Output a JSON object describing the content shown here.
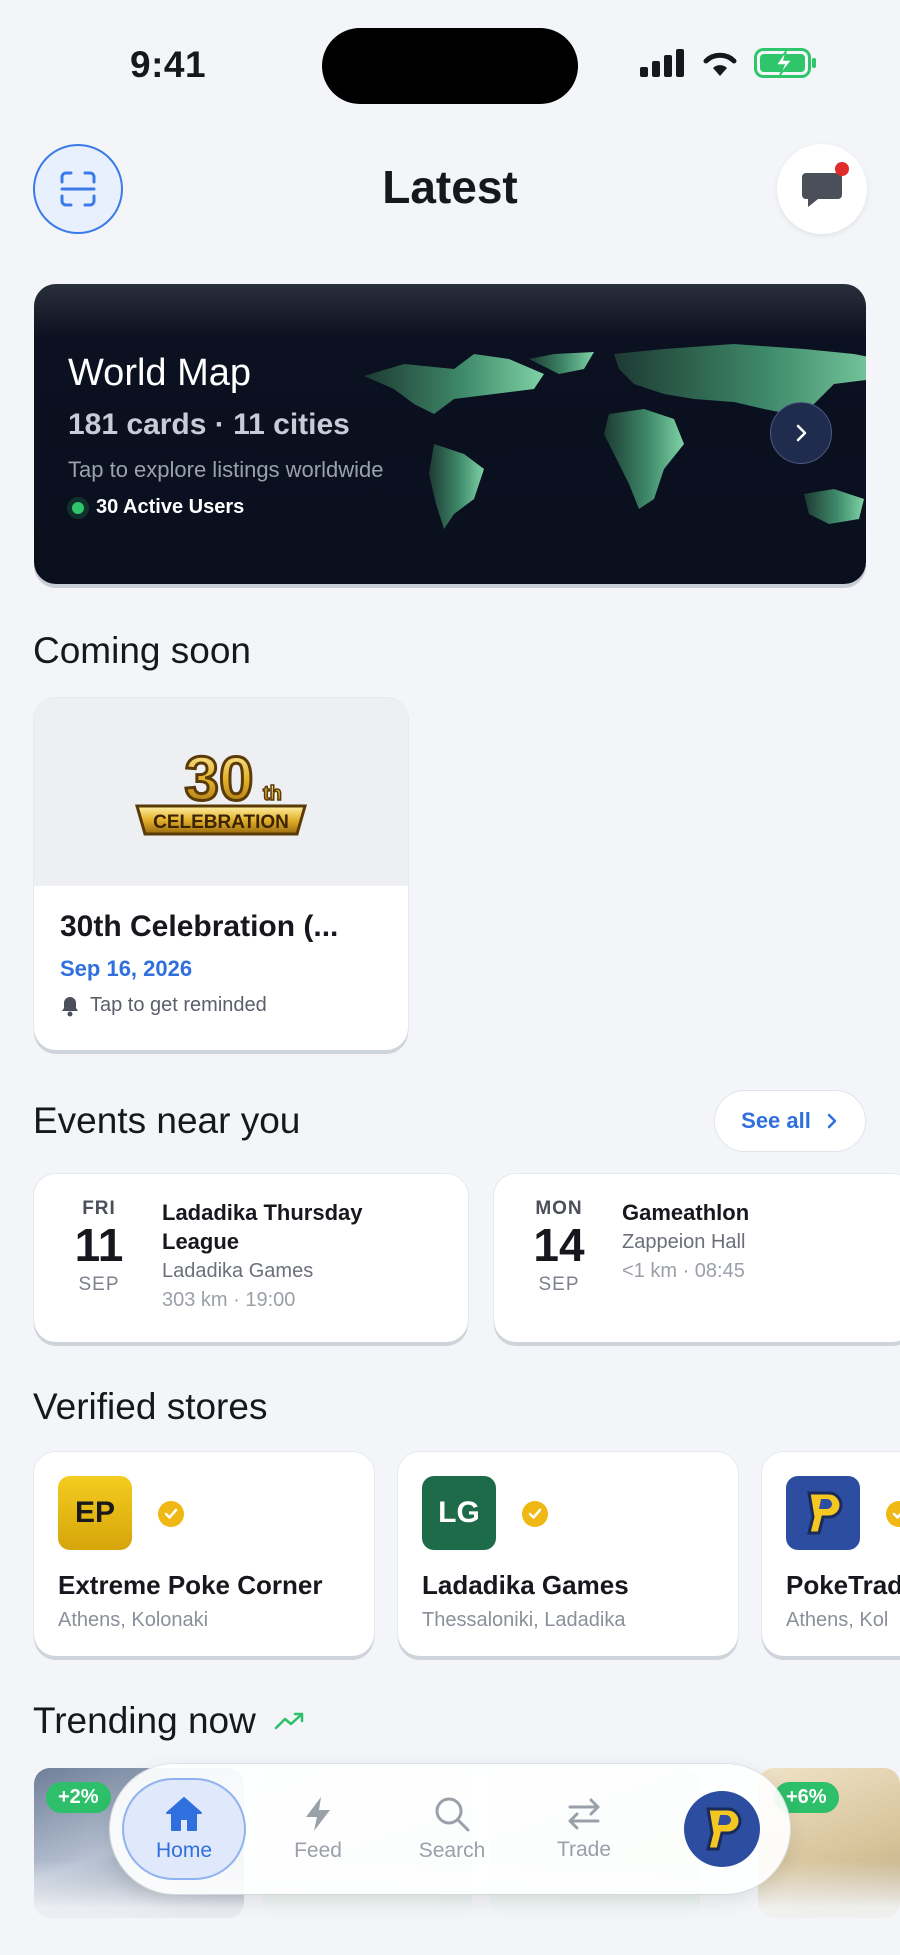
{
  "status_bar": {
    "time": "9:41"
  },
  "header": {
    "title": "Latest"
  },
  "world_map": {
    "title": "World Map",
    "subtitle": "181 cards · 11 cities",
    "hint": "Tap to explore listings worldwide",
    "active_users": "30 Active Users"
  },
  "coming_soon": {
    "section_title": "Coming soon",
    "items": [
      {
        "logo_text": "30th CELEBRATION",
        "title": "30th Celebration (...",
        "date": "Sep 16, 2026",
        "remind": "Tap to get reminded"
      }
    ]
  },
  "events": {
    "section_title": "Events near you",
    "see_all": "See all",
    "items": [
      {
        "dow": "FRI",
        "day": "11",
        "month": "SEP",
        "name": "Ladadika Thursday League",
        "place": "Ladadika Games",
        "meta": "303 km · 19:00"
      },
      {
        "dow": "MON",
        "day": "14",
        "month": "SEP",
        "name": "Gameathlon",
        "place": "Zappeion Hall",
        "meta": "<1 km · 08:45"
      }
    ]
  },
  "stores": {
    "section_title": "Verified stores",
    "items": [
      {
        "initials": "EP",
        "name": "Extreme Poke Corner",
        "location": "Athens, Kolonaki",
        "color": "#f1c40f"
      },
      {
        "initials": "LG",
        "name": "Ladadika Games",
        "location": "Thessaloniki, Ladadika",
        "color": "#1e6b49"
      },
      {
        "initials": "P",
        "name": "PokeTrad",
        "location": "Athens, Kol",
        "color": "#2d4da0"
      }
    ]
  },
  "trending": {
    "section_title": "Trending now",
    "badges": [
      "+2%",
      "+6%"
    ]
  },
  "nav": {
    "items": [
      {
        "label": "Home"
      },
      {
        "label": "Feed"
      },
      {
        "label": "Search"
      },
      {
        "label": "Trade"
      }
    ]
  },
  "colors": {
    "accent": "#2f6fde",
    "verified": "#f0b814",
    "online": "#2fc56b",
    "trend": "#2dbf6a"
  }
}
